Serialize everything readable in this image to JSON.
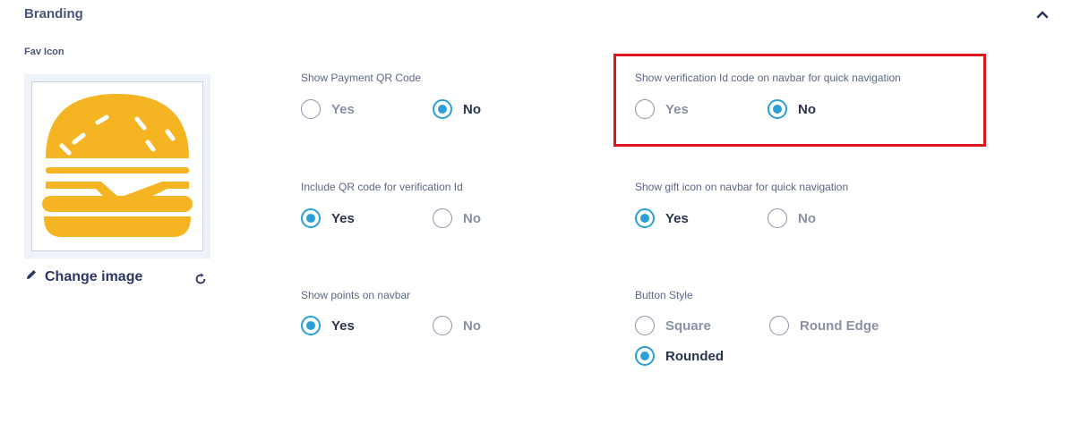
{
  "section": {
    "title": "Branding"
  },
  "favicon": {
    "label": "Fav Icon",
    "change_label": "Change image"
  },
  "settings": {
    "payment_qr": {
      "label": "Show Payment QR Code",
      "options": [
        "Yes",
        "No"
      ],
      "selected": "No"
    },
    "verification_navbar": {
      "label": "Show verification Id code on navbar for quick navigation",
      "options": [
        "Yes",
        "No"
      ],
      "selected": "No"
    },
    "include_qr": {
      "label": "Include QR code for verification Id",
      "options": [
        "Yes",
        "No"
      ],
      "selected": "Yes"
    },
    "gift_icon": {
      "label": "Show gift icon on navbar for quick navigation",
      "options": [
        "Yes",
        "No"
      ],
      "selected": "Yes"
    },
    "points_navbar": {
      "label": "Show points on navbar",
      "options": [
        "Yes",
        "No"
      ],
      "selected": "Yes"
    },
    "button_style": {
      "label": "Button Style",
      "options": [
        "Square",
        "Round Edge",
        "Rounded"
      ],
      "selected": "Rounded"
    }
  },
  "colors": {
    "accent": "#2b9fd8",
    "highlight": "#e0141f",
    "burger": "#f5b523"
  }
}
